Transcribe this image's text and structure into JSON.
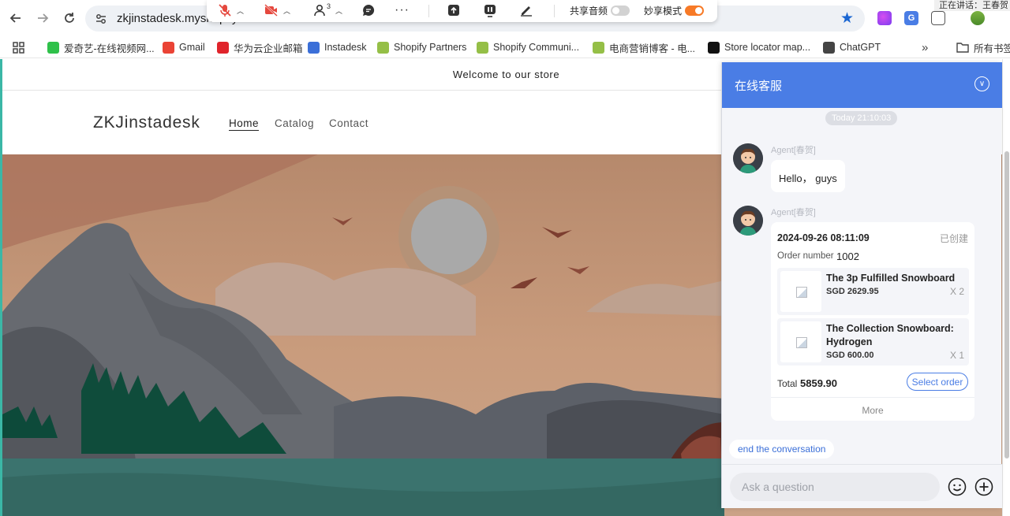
{
  "browser": {
    "url": "zkjinstadesk.myshopify.com",
    "speaking_label": "正在讲话：王春贺",
    "bookmarks": [
      {
        "label": "爱奇艺-在线视频网...",
        "icon": "iqiyi-icon",
        "color": "#2fc14a"
      },
      {
        "label": "Gmail",
        "icon": "gmail-icon",
        "color": "#ea4335"
      },
      {
        "label": "华为云企业邮箱",
        "icon": "huawei-icon",
        "color": "#e0242b"
      },
      {
        "label": "Instadesk",
        "icon": "instadesk-icon",
        "color": "#3b6fd8"
      },
      {
        "label": "Shopify Partners",
        "icon": "shopify-icon",
        "color": "#95bf47"
      },
      {
        "label": "Shopify Communi...",
        "icon": "shopify-icon",
        "color": "#95bf47"
      },
      {
        "label": "电商营销博客 - 电...",
        "icon": "shopify-icon",
        "color": "#95bf47"
      },
      {
        "label": "Store locator map...",
        "icon": "store-locator-icon",
        "color": "#111111"
      },
      {
        "label": "ChatGPT",
        "icon": "chatgpt-icon",
        "color": "#444444"
      }
    ],
    "all_bookmarks_label": "所有书签"
  },
  "meeting_toolbar": {
    "participant_count": "3",
    "share_audio_label": "共享音频",
    "share_audio_on": false,
    "share_mode_label": "妙享模式",
    "share_mode_on": true
  },
  "store": {
    "announcement": "Welcome to our store",
    "logo": "ZKJinstadesk",
    "menu": [
      {
        "label": "Home",
        "active": true
      },
      {
        "label": "Catalog",
        "active": false
      },
      {
        "label": "Contact",
        "active": false
      }
    ]
  },
  "chat": {
    "title": "在线客服",
    "timestamp": "Today 21:10:03",
    "agent_name": "Agent[春贺]",
    "greeting": "Hello， guys",
    "order": {
      "date": "2024-09-26 08:11:09",
      "status": "已创建",
      "number_label": "Order number",
      "number": "1002",
      "items": [
        {
          "name": "The 3p Fulfilled Snowboard",
          "price": "SGD 2629.95",
          "qty": "X 2"
        },
        {
          "name": "The Collection Snowboard: Hydrogen",
          "price": "SGD 600.00",
          "qty": "X 1"
        }
      ],
      "total_label": "Total",
      "total": "5859.90",
      "select_label": "Select order",
      "more_label": "More"
    },
    "end_conversation": "end the conversation",
    "input_placeholder": "Ask a question",
    "accent": "#4a7de5"
  }
}
